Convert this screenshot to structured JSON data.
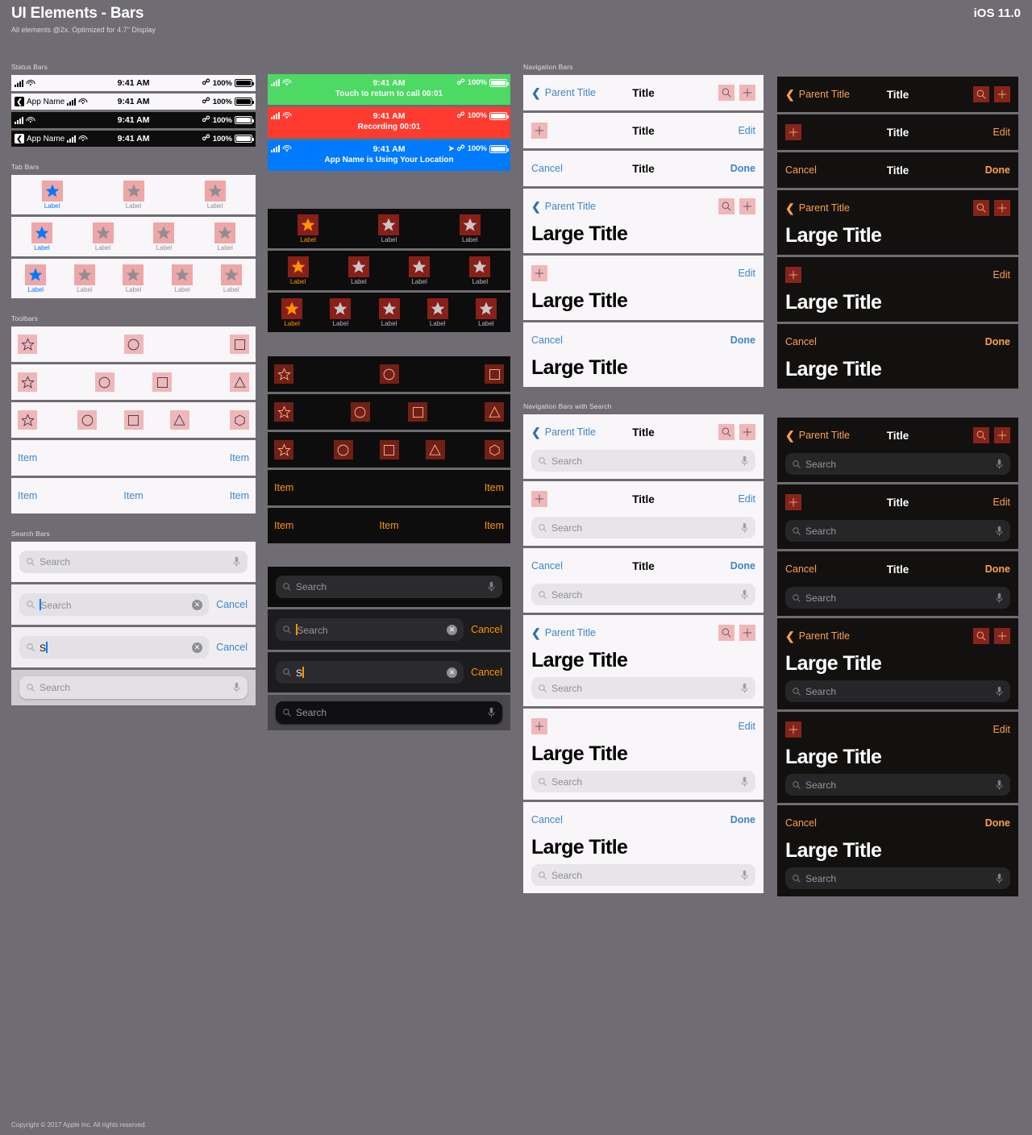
{
  "header": {
    "title": "UI Elements - Bars",
    "subtitle": "All elements @2x. Optimized for 4.7\" Display",
    "version": "iOS 11.0"
  },
  "footer": {
    "copyright": "Copyright © 2017 Apple Inc. All rights reserved."
  },
  "sections": {
    "status_bars": "Status Bars",
    "tab_bars": "Tab Bars",
    "toolbars": "Toolbars",
    "search_bars": "Search Bars",
    "navigation_bars": "Navigation Bars",
    "navigation_bars_with_search": "Navigation Bars with Search"
  },
  "colors": {
    "background": "#706c73",
    "light_bar": "#f9f6f9",
    "dark_bar": "#0d0d0d",
    "tint_light": "#007aff",
    "tint_dark": "#ff9500",
    "link_light": "#3c87c9",
    "in_call_green": "#4cd964",
    "recording_red": "#ff3b30",
    "location_blue": "#007aff",
    "placeholder_box": "#e87a7a"
  },
  "status_bar": {
    "time": "9:41 AM",
    "battery_pct": "100%",
    "app_name": "App Name",
    "messages": {
      "call": "Touch to return to call 00:01",
      "recording": "Recording 00:01",
      "location": "App Name is Using Your Location"
    }
  },
  "tab_bars": {
    "label": "Label",
    "counts": [
      3,
      4,
      5
    ]
  },
  "toolbars": {
    "item": "Item",
    "shape_rows": [
      [
        "star",
        "circle",
        "square"
      ],
      [
        "star",
        "circle",
        "square",
        "triangle"
      ],
      [
        "star",
        "circle",
        "square",
        "triangle",
        "hexagon"
      ]
    ],
    "item_rows": [
      2,
      3
    ]
  },
  "search_bars": {
    "placeholder": "Search",
    "typed_value": "S",
    "cancel": "Cancel"
  },
  "nav_bars": {
    "parent_title": "Parent Title",
    "title": "Title",
    "large_title": "Large Title",
    "edit": "Edit",
    "cancel": "Cancel",
    "done": "Done",
    "search_placeholder": "Search"
  }
}
